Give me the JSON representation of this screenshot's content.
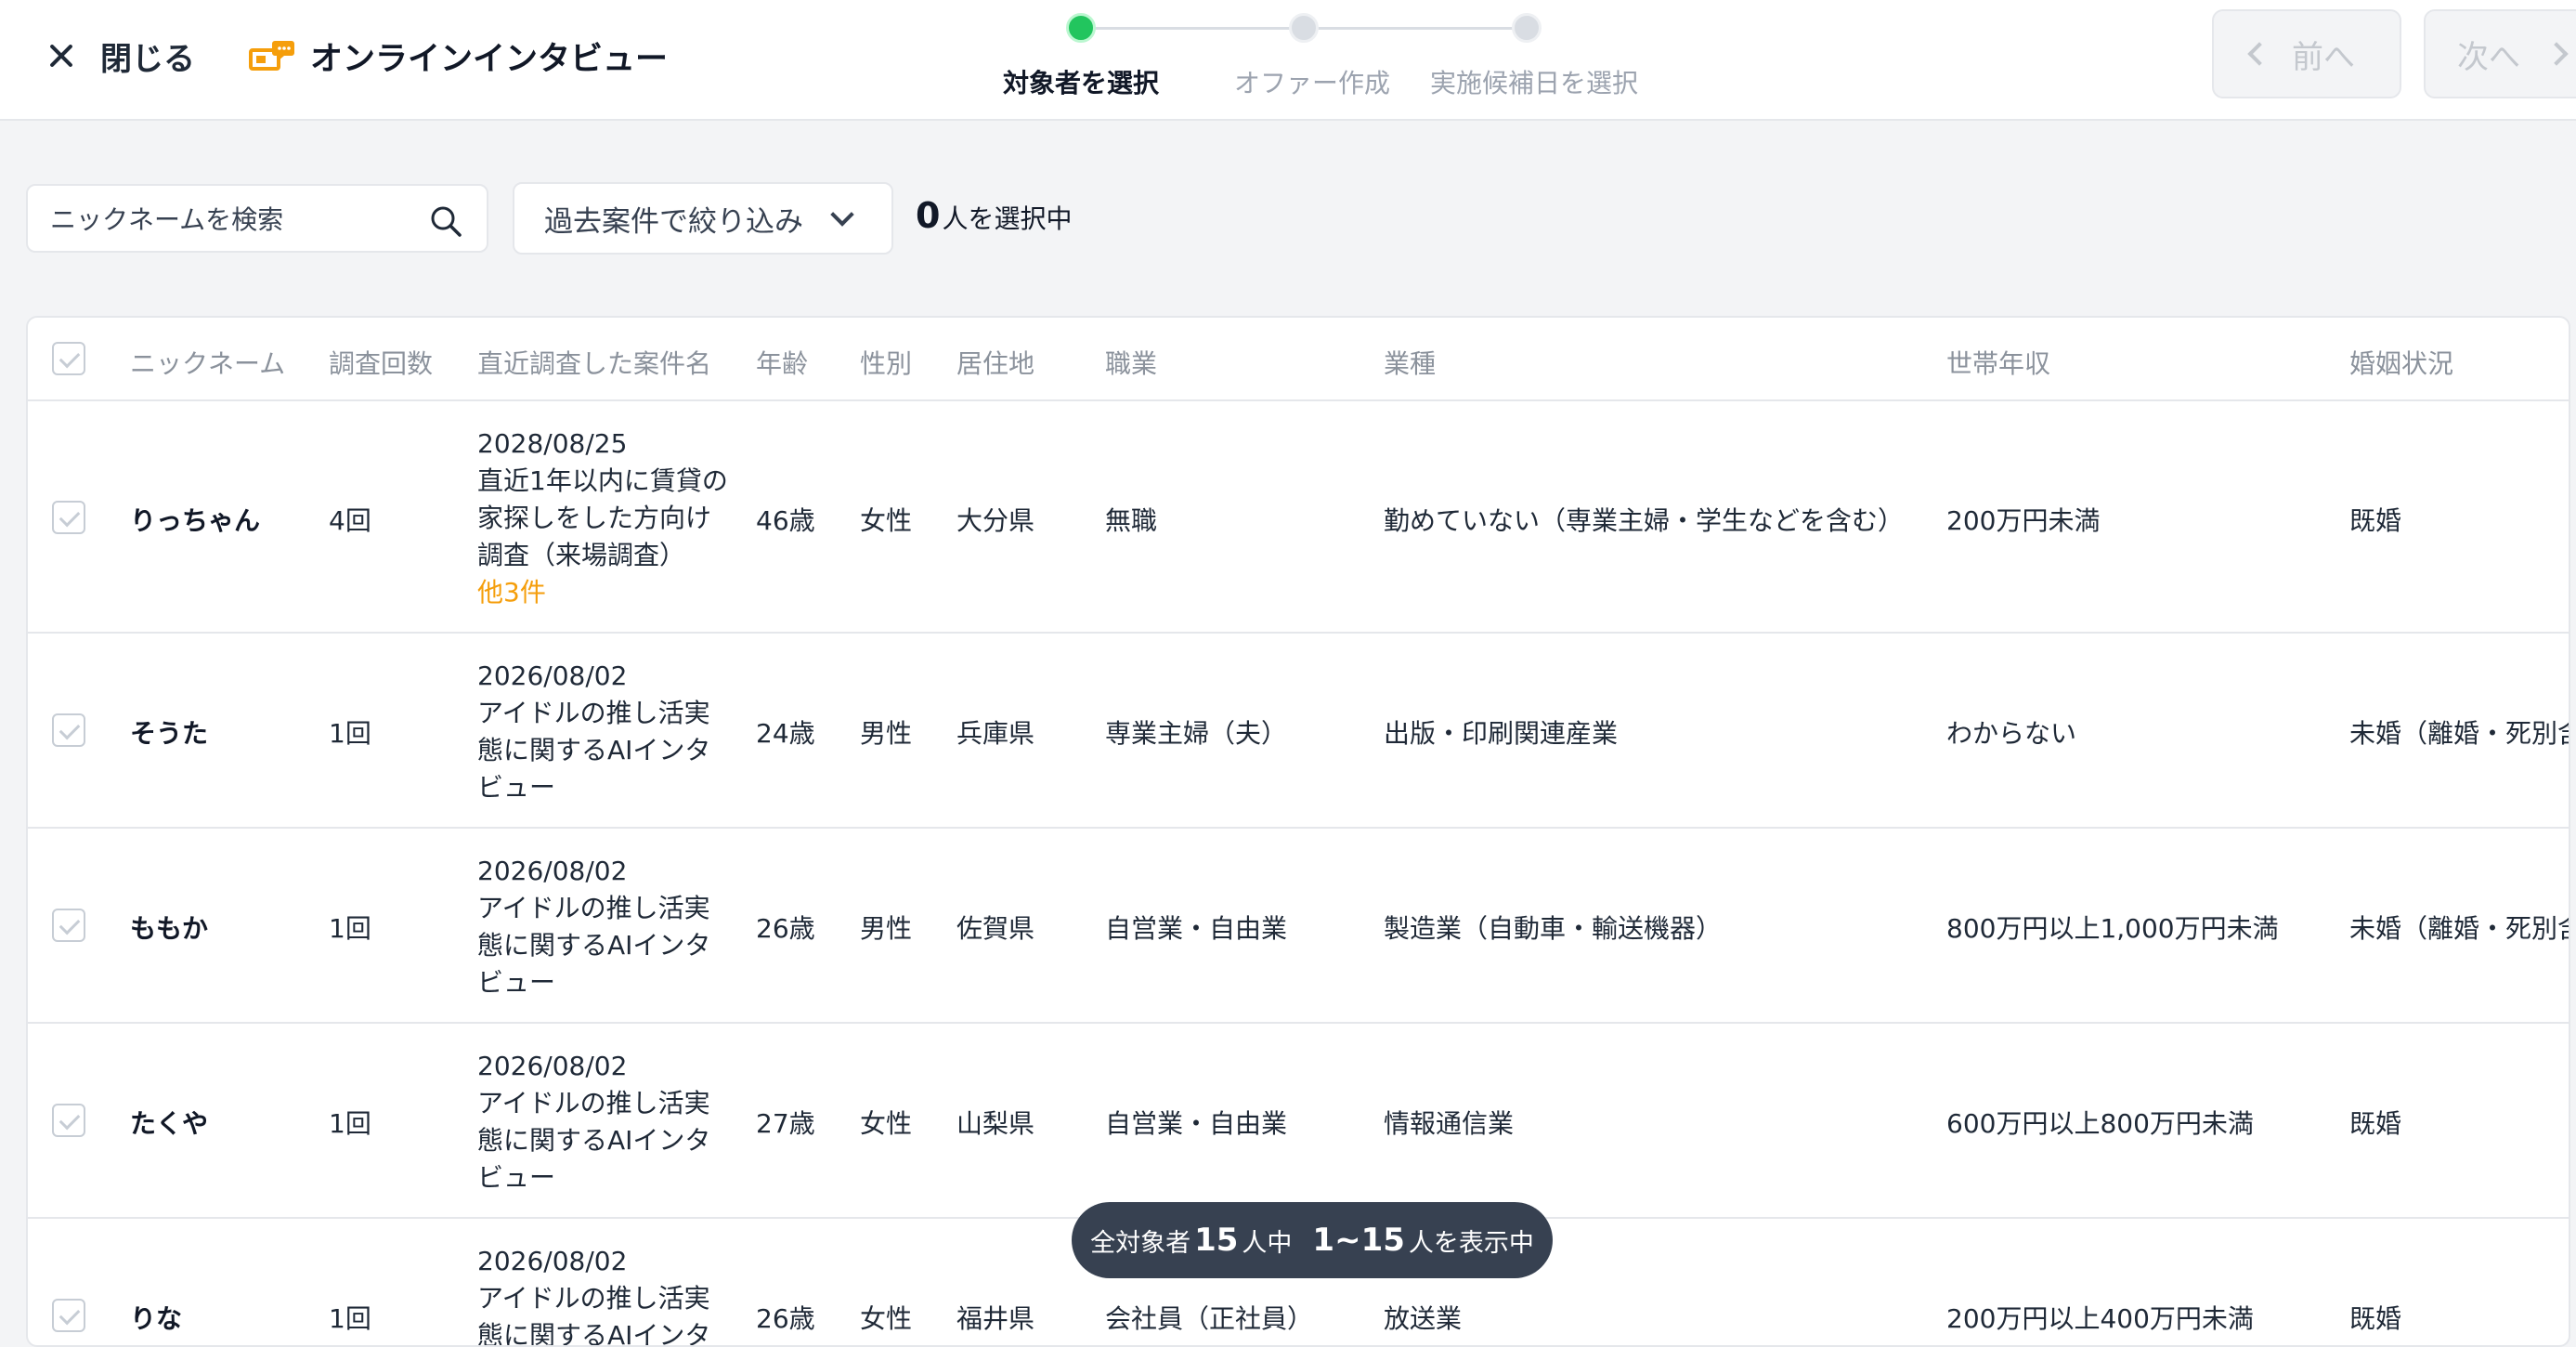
{
  "header": {
    "close_label": "閉じる",
    "app_title": "オンラインインタビュー",
    "steps": [
      {
        "label": "対象者を選択",
        "active": true
      },
      {
        "label": "オファー作成",
        "active": false
      },
      {
        "label": "実施候補日を選択",
        "active": false
      }
    ],
    "prev_label": "前へ",
    "next_label": "次へ"
  },
  "toolbar": {
    "search_placeholder": "ニックネームを検索",
    "filter_label": "過去案件で絞り込み",
    "selected_num": "0",
    "selected_suffix": "人を選択中"
  },
  "table": {
    "columns": [
      "ニックネーム",
      "調査回数",
      "直近調査した案件名",
      "年齢",
      "性別",
      "居住地",
      "職業",
      "業種",
      "世帯年収",
      "婚姻状況"
    ],
    "rows": [
      {
        "nickname": "りっちゃん",
        "count": "4回",
        "project_date": "2028/08/25",
        "project_name": "直近1年以内に賃貸の家探しをした方向け調査（来場調査）",
        "project_more": "他3件",
        "age": "46歳",
        "gender": "女性",
        "residence": "大分県",
        "occupation": "無職",
        "industry": "勤めていない（専業主婦・学生などを含む）",
        "income": "200万円未満",
        "marital": "既婚"
      },
      {
        "nickname": "そうた",
        "count": "1回",
        "project_date": "2026/08/02",
        "project_name": "アイドルの推し活実態に関するAIインタビュー",
        "project_more": "",
        "age": "24歳",
        "gender": "男性",
        "residence": "兵庫県",
        "occupation": "専業主婦（夫）",
        "industry": "出版・印刷関連産業",
        "income": "わからない",
        "marital": "未婚（離婚・死別含"
      },
      {
        "nickname": "ももか",
        "count": "1回",
        "project_date": "2026/08/02",
        "project_name": "アイドルの推し活実態に関するAIインタビュー",
        "project_more": "",
        "age": "26歳",
        "gender": "男性",
        "residence": "佐賀県",
        "occupation": "自営業・自由業",
        "industry": "製造業（自動車・輸送機器）",
        "income": "800万円以上1,000万円未満",
        "marital": "未婚（離婚・死別含"
      },
      {
        "nickname": "たくや",
        "count": "1回",
        "project_date": "2026/08/02",
        "project_name": "アイドルの推し活実態に関するAIインタビュー",
        "project_more": "",
        "age": "27歳",
        "gender": "女性",
        "residence": "山梨県",
        "occupation": "自営業・自由業",
        "industry": "情報通信業",
        "income": "600万円以上800万円未満",
        "marital": "既婚"
      },
      {
        "nickname": "りな",
        "count": "1回",
        "project_date": "2026/08/02",
        "project_name": "アイドルの推し活実態に関するAIインタビュー",
        "project_more": "",
        "age": "26歳",
        "gender": "女性",
        "residence": "福井県",
        "occupation": "会社員（正社員）",
        "industry": "放送業",
        "income": "200万円以上400万円未満",
        "marital": "既婚"
      }
    ]
  },
  "toast": {
    "prefix": "全対象者",
    "total": "15",
    "mid": "人中",
    "range": "1~15",
    "suffix": "人を表示中"
  },
  "colors": {
    "accent_green": "#22c55e",
    "more_orange": "#f59e0b",
    "toast_bg": "#374151"
  }
}
